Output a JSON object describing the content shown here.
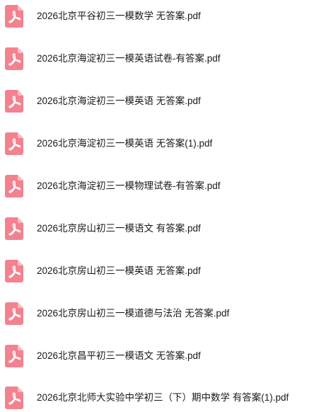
{
  "files": [
    {
      "name": "2026北京平谷初三一模数学 无答案.pdf",
      "icon": "pdf-file-icon"
    },
    {
      "name": "2026北京海淀初三一模英语试卷-有答案.pdf",
      "icon": "pdf-file-icon"
    },
    {
      "name": "2026北京海淀初三一模英语 无答案.pdf",
      "icon": "pdf-file-icon"
    },
    {
      "name": "2026北京海淀初三一模英语 无答案(1).pdf",
      "icon": "pdf-file-icon"
    },
    {
      "name": "2026北京海淀初三一模物理试卷-有答案.pdf",
      "icon": "pdf-file-icon"
    },
    {
      "name": "2026北京房山初三一模语文 有答案.pdf",
      "icon": "pdf-file-icon"
    },
    {
      "name": "2026北京房山初三一模英语 无答案.pdf",
      "icon": "pdf-file-icon"
    },
    {
      "name": "2026北京房山初三一模道德与法治 无答案.pdf",
      "icon": "pdf-file-icon"
    },
    {
      "name": "2026北京昌平初三一模语文 无答案.pdf",
      "icon": "pdf-file-icon"
    },
    {
      "name": "2026北京北师大实验中学初三（下）期中数学 有答案(1).pdf",
      "icon": "pdf-file-icon"
    }
  ],
  "colors": {
    "icon_pink": "#f3828f",
    "icon_fold": "#f9bcc3",
    "text": "#1a1a1a"
  }
}
